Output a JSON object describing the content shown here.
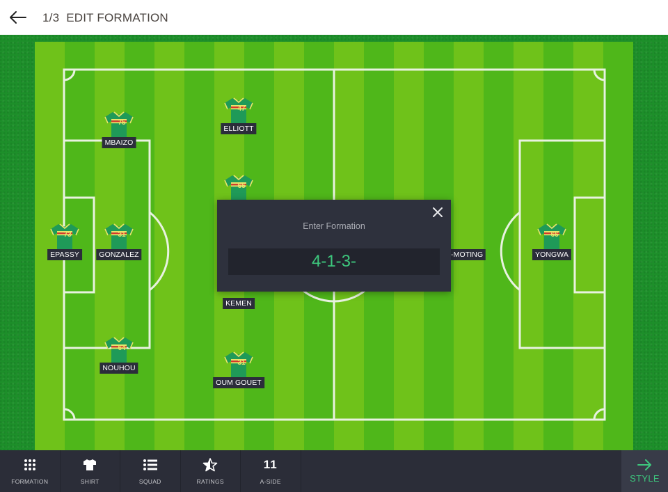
{
  "header": {
    "step": "1/3",
    "title": "EDIT FORMATION",
    "back_icon": "arrow-left-icon"
  },
  "colors": {
    "accent": "#3dc77d",
    "bar_bg": "#2b2d38",
    "modal_bg": "#2e313d",
    "shirt_body": "#1f9a58",
    "shirt_trim": "#e8e46a",
    "shirt_stripe": "#d9342b"
  },
  "players": [
    {
      "name": "EPASSY",
      "number": "73"
    },
    {
      "name": "MBAIZO",
      "number": "75"
    },
    {
      "name": "GONZALEZ",
      "number": "31"
    },
    {
      "name": "NOUHOU",
      "number": "64"
    },
    {
      "name": "ELLIOTT",
      "number": "47"
    },
    {
      "name": "",
      "number": "66"
    },
    {
      "name": "KEMEN",
      "number": ""
    },
    {
      "name": "OUM GOUET",
      "number": "31"
    },
    {
      "name": "O-MOTING",
      "number": ""
    },
    {
      "name": "YONGWA",
      "number": "66"
    }
  ],
  "modal": {
    "title": "Enter Formation",
    "value": "4-1-3-",
    "close_icon": "close-icon"
  },
  "bottom_bar": {
    "tabs": [
      {
        "label": "FORMATION",
        "icon": "grid-dots-icon"
      },
      {
        "label": "SHIRT",
        "icon": "shirt-icon"
      },
      {
        "label": "SQUAD",
        "icon": "list-icon"
      },
      {
        "label": "RATINGS",
        "icon": "half-star-icon"
      },
      {
        "label": "A-SIDE",
        "value": "11"
      }
    ],
    "next": {
      "label": "STYLE",
      "icon": "arrow-right-icon"
    }
  }
}
